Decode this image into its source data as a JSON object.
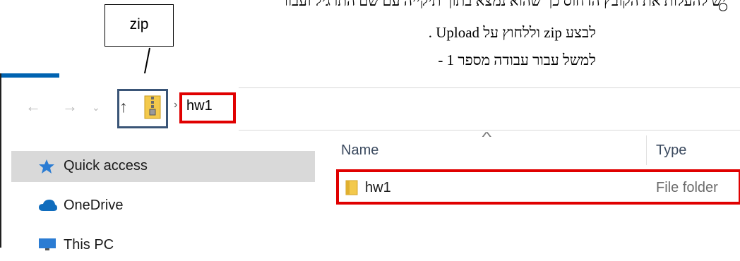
{
  "instructions": {
    "line1": "יש להעלות את הקובץ הדחוס כך שהוא נמצא בתוך תיקייה עם שם התרגיל ועבור",
    "line2": "לבצע zip וללחוץ על Upload .",
    "line3": "למשל עבור עבודה מספר 1 -"
  },
  "callout": {
    "label": "zip"
  },
  "toolbar": {
    "back_icon": "arrow-left-icon",
    "forward_icon": "arrow-right-icon",
    "recent_icon": "chevron-down-icon",
    "up_icon": "arrow-up-icon",
    "zip_icon": "zip-folder-icon",
    "breadcrumb_separator": "›",
    "breadcrumb_current": "hw1"
  },
  "sidebar": {
    "items": [
      {
        "label": "Quick access",
        "icon": "star-icon",
        "selected": true
      },
      {
        "label": "OneDrive",
        "icon": "cloud-icon",
        "selected": false
      },
      {
        "label": "This PC",
        "icon": "monitor-icon",
        "selected": false
      }
    ]
  },
  "file_list": {
    "columns": [
      "Name",
      "Type"
    ],
    "sort_indicator": "^",
    "rows": [
      {
        "name": "hw1",
        "type": "File folder",
        "icon": "folder-icon"
      }
    ]
  },
  "colors": {
    "highlight_red": "#e00000",
    "nav_box_blue": "#3a5577",
    "accent_blue": "#0063b1",
    "sidebar_selected": "#d9d9d9"
  }
}
